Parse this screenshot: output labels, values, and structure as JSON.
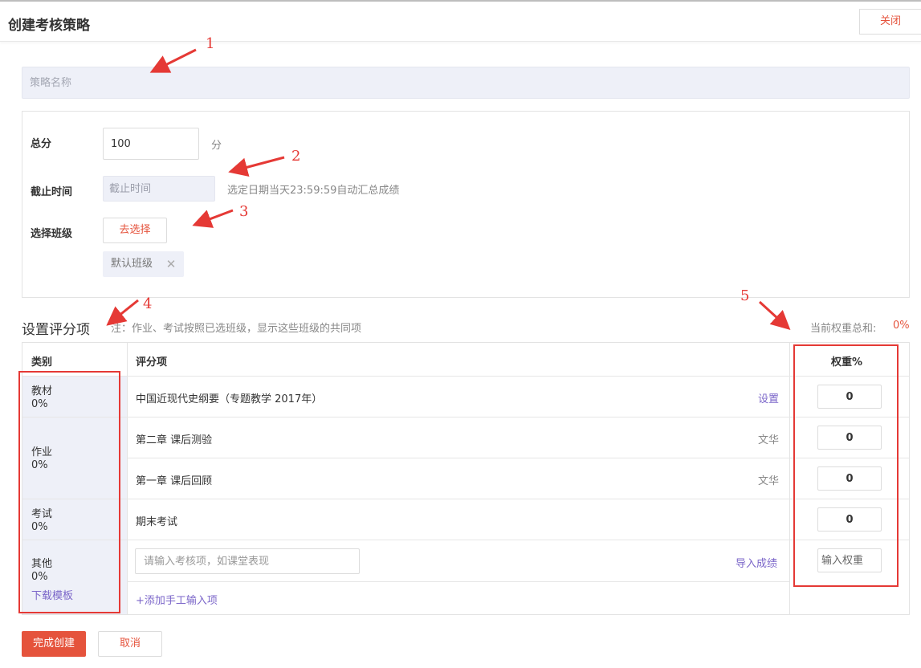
{
  "header": {
    "title": "创建考核策略",
    "close_label": "关闭"
  },
  "form": {
    "name_placeholder": "策略名称",
    "total_score_label": "总分",
    "total_score_value": "100",
    "score_unit": "分",
    "deadline_label": "截止时间",
    "deadline_placeholder": "截止时间",
    "deadline_hint": "选定日期当天23:59:59自动汇总成绩",
    "class_label": "选择班级",
    "choose_button": "去选择",
    "class_tag": "默认班级",
    "tag_close_glyph": "✕"
  },
  "scoring": {
    "section_title": "设置评分项",
    "note": "注：作业、考试按照已选班级，显示这些班级的共同项",
    "weight_sum_label": "当前权重总和:",
    "weight_sum_value": "0%",
    "headers": {
      "category": "类别",
      "item": "评分项",
      "weight": "权重%"
    },
    "categories": [
      {
        "name": "教材",
        "pct": "0%"
      },
      {
        "name": "作业",
        "pct": "0%"
      },
      {
        "name": "考试",
        "pct": "0%"
      },
      {
        "name": "其他",
        "pct": "0%",
        "link": "下载模板"
      }
    ],
    "items": [
      {
        "name": "中国近现代史纲要（专题教学 2017年）",
        "action": "设置",
        "weight": "0"
      },
      {
        "name": "第二章 课后测验",
        "author": "文华",
        "weight": "0"
      },
      {
        "name": "第一章 课后回顾",
        "author": "文华",
        "weight": "0"
      },
      {
        "name": "期末考试",
        "weight": "0"
      }
    ],
    "other_item_placeholder": "请输入考核项，如课堂表现",
    "import_label": "导入成绩",
    "other_weight_placeholder": "输入权重",
    "add_item_label": "+添加手工输入项"
  },
  "footer": {
    "submit_label": "完成创建",
    "cancel_label": "取消"
  },
  "annotations": [
    "1",
    "2",
    "3",
    "4",
    "5"
  ],
  "colors": {
    "accent": "#e5533c",
    "link": "#7b66c9",
    "annotation": "#e53935",
    "category_bg": "#eef0f8"
  }
}
